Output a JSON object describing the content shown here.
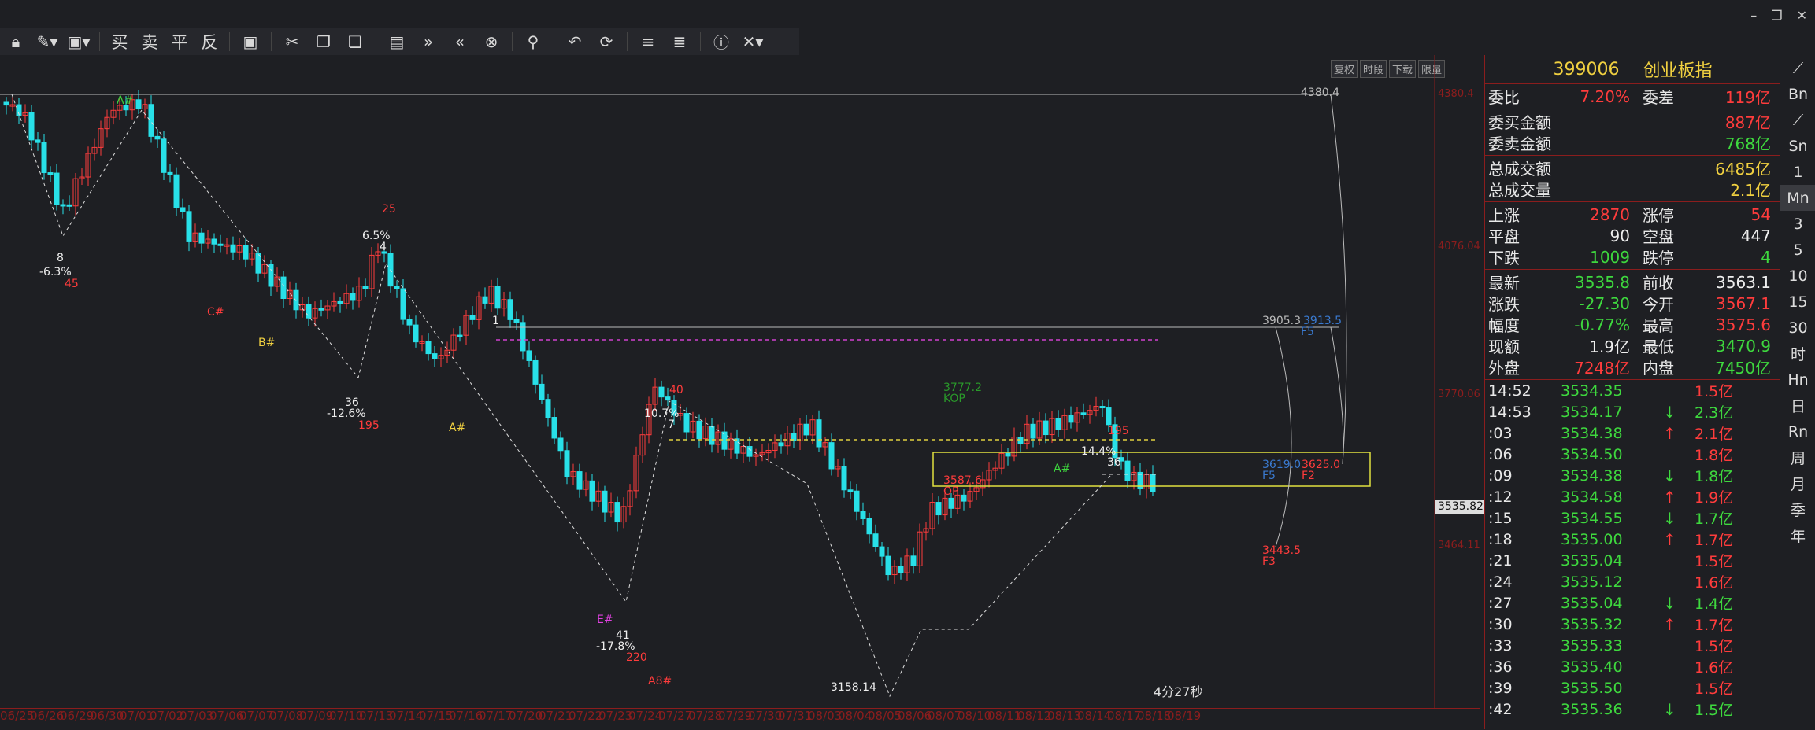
{
  "window_controls": [
    "–",
    "❐",
    "✕"
  ],
  "toolbar": {
    "lock_icon": "lock-icon",
    "draw_icon": "pen-icon",
    "save_icon": "save-icon",
    "buy": "买",
    "sell": "卖",
    "flat": "平",
    "reverse": "反",
    "icons": [
      "save-icon",
      "cut-icon",
      "copy-icon",
      "paste-icon",
      "layout-icon",
      "forward-icon",
      "back-icon",
      "cancel-icon",
      "search-icon",
      "undo-icon",
      "refresh-icon",
      "align-left-icon",
      "align-right-icon",
      "info-icon",
      "close-icon"
    ]
  },
  "chart_top_buttons": [
    "复权",
    "时段",
    "下载",
    "限量"
  ],
  "chart_labels": {
    "high_level": "4380.4",
    "level_3905": "3905.3",
    "level_3913": "3913.5",
    "f5_a": "F5",
    "level_3619": "3619.0",
    "f5_b": "F5",
    "level_3625": "3625.0",
    "f2": "F2",
    "level_3443": "3443.5",
    "f3": "F3",
    "level_3587": "3587.6",
    "op": "OP",
    "level_3777": "3777.2",
    "op2": "KOP",
    "low_label": "3158.14",
    "price_marker": "3535.82",
    "axis_4380": "4380.4",
    "axis_4076": "4076.04",
    "axis_3770": "3770.06",
    "axis_3464": "3464.11",
    "timer": "4分27秒"
  },
  "annotations": [
    {
      "text": "8",
      "color": "#eee"
    },
    {
      "text": "-6.3%",
      "color": "#eee"
    },
    {
      "text": "45",
      "color": "#ff3c3c"
    },
    {
      "text": "6.5%",
      "color": "#eee"
    },
    {
      "text": "4",
      "color": "#eee"
    },
    {
      "text": "25",
      "color": "#ff3c3c"
    },
    {
      "text": "36",
      "color": "#eee"
    },
    {
      "text": "-12.6%",
      "color": "#eee"
    },
    {
      "text": "195",
      "color": "#ff3c3c"
    },
    {
      "text": "10.7%",
      "color": "#eee"
    },
    {
      "text": "7",
      "color": "#eee"
    },
    {
      "text": "40",
      "color": "#ff3c3c"
    },
    {
      "text": "41",
      "color": "#eee"
    },
    {
      "text": "-17.8%",
      "color": "#eee"
    },
    {
      "text": "220",
      "color": "#ff3c3c"
    },
    {
      "text": "14.4%",
      "color": "#eee"
    },
    {
      "text": "36",
      "color": "#eee"
    },
    {
      "text": "195",
      "color": "#ff3c3c"
    },
    {
      "text": "1",
      "color": "#eee"
    },
    {
      "text": "A#",
      "color": "#3ed83e"
    },
    {
      "text": "B#",
      "color": "#f0d040"
    },
    {
      "text": "C#",
      "color": "#ff3c3c"
    },
    {
      "text": "A#",
      "color": "#f0d040"
    },
    {
      "text": "E#",
      "color": "#e040e0"
    },
    {
      "text": "A8#",
      "color": "#ff3c3c"
    },
    {
      "text": "A#",
      "color": "#3ed83e"
    }
  ],
  "x_axis": [
    "06/25",
    "06/26",
    "06/29",
    "06/30",
    "07/01",
    "07/02",
    "07/03",
    "07/06",
    "07/07",
    "07/08",
    "07/09",
    "07/10",
    "07/13",
    "07/14",
    "07/15",
    "07/16",
    "07/17",
    "07/20",
    "07/21",
    "07/22",
    "07/23",
    "07/24",
    "07/27",
    "07/28",
    "07/29",
    "07/30",
    "07/31",
    "08/03",
    "08/04",
    "08/05",
    "08/06",
    "08/07",
    "08/10",
    "08/11",
    "08/12",
    "08/13",
    "08/14",
    "08/17",
    "08/18",
    "08/19"
  ],
  "panel": {
    "code": "399006",
    "name": "创业板指",
    "rows1": [
      {
        "l": "委比",
        "v": "7.20%",
        "c": "#ff3c3c",
        "l2": "委差",
        "v2": "119亿",
        "c2": "#ff3c3c"
      }
    ],
    "rows2": [
      {
        "l": "委买金额",
        "v": "887亿",
        "c": "#ff3c3c"
      },
      {
        "l": "委卖金额",
        "v": "768亿",
        "c": "#3ed83e"
      }
    ],
    "rows3": [
      {
        "l": "总成交额",
        "v": "6485亿",
        "c": "#f0d040"
      },
      {
        "l": "总成交量",
        "v": "2.1亿",
        "c": "#f0d040"
      }
    ],
    "rows4": [
      {
        "l": "上涨",
        "v": "2870",
        "c": "#ff3c3c",
        "l2": "涨停",
        "v2": "54",
        "c2": "#ff3c3c"
      },
      {
        "l": "平盘",
        "v": "90",
        "c": "#eee",
        "l2": "空盘",
        "v2": "447",
        "c2": "#eee"
      },
      {
        "l": "下跌",
        "v": "1009",
        "c": "#3ed83e",
        "l2": "跌停",
        "v2": "4",
        "c2": "#3ed83e"
      }
    ],
    "rows5": [
      {
        "l": "最新",
        "v": "3535.8",
        "c": "#3ed83e",
        "l2": "前收",
        "v2": "3563.1",
        "c2": "#eee"
      },
      {
        "l": "涨跌",
        "v": "-27.30",
        "c": "#3ed83e",
        "l2": "今开",
        "v2": "3567.1",
        "c2": "#ff3c3c"
      },
      {
        "l": "幅度",
        "v": "-0.77%",
        "c": "#3ed83e",
        "l2": "最高",
        "v2": "3575.6",
        "c2": "#ff3c3c"
      },
      {
        "l": "现额",
        "v": "1.9亿",
        "c": "#eee",
        "l2": "最低",
        "v2": "3470.9",
        "c2": "#3ed83e"
      },
      {
        "l": "外盘",
        "v": "7248亿",
        "c": "#ff3c3c",
        "l2": "内盘",
        "v2": "7450亿",
        "c2": "#3ed83e"
      }
    ],
    "ticks": [
      {
        "t": "14:52",
        "p": "3534.35",
        "a": "",
        "ac": "#eee",
        "v": "1.5亿",
        "vc": "#ff3c3c"
      },
      {
        "t": "14:53",
        "p": "3534.17",
        "a": "↓",
        "ac": "#3ed83e",
        "v": "2.3亿",
        "vc": "#3ed83e"
      },
      {
        "t": ":03",
        "p": "3534.38",
        "a": "↑",
        "ac": "#ff3c3c",
        "v": "2.1亿",
        "vc": "#ff3c3c"
      },
      {
        "t": ":06",
        "p": "3534.50",
        "a": "",
        "ac": "#eee",
        "v": "1.8亿",
        "vc": "#ff3c3c"
      },
      {
        "t": ":09",
        "p": "3534.38",
        "a": "↓",
        "ac": "#3ed83e",
        "v": "1.8亿",
        "vc": "#3ed83e"
      },
      {
        "t": ":12",
        "p": "3534.58",
        "a": "↑",
        "ac": "#ff3c3c",
        "v": "1.9亿",
        "vc": "#ff3c3c"
      },
      {
        "t": ":15",
        "p": "3534.55",
        "a": "↓",
        "ac": "#3ed83e",
        "v": "1.7亿",
        "vc": "#3ed83e"
      },
      {
        "t": ":18",
        "p": "3535.00",
        "a": "↑",
        "ac": "#ff3c3c",
        "v": "1.7亿",
        "vc": "#ff3c3c"
      },
      {
        "t": ":21",
        "p": "3535.04",
        "a": "",
        "ac": "#eee",
        "v": "1.5亿",
        "vc": "#ff3c3c"
      },
      {
        "t": ":24",
        "p": "3535.12",
        "a": "",
        "ac": "#eee",
        "v": "1.6亿",
        "vc": "#ff3c3c"
      },
      {
        "t": ":27",
        "p": "3535.04",
        "a": "↓",
        "ac": "#3ed83e",
        "v": "1.4亿",
        "vc": "#3ed83e"
      },
      {
        "t": ":30",
        "p": "3535.32",
        "a": "↑",
        "ac": "#ff3c3c",
        "v": "1.7亿",
        "vc": "#ff3c3c"
      },
      {
        "t": ":33",
        "p": "3535.33",
        "a": "",
        "ac": "#eee",
        "v": "1.5亿",
        "vc": "#ff3c3c"
      },
      {
        "t": ":36",
        "p": "3535.40",
        "a": "",
        "ac": "#eee",
        "v": "1.6亿",
        "vc": "#ff3c3c"
      },
      {
        "t": ":39",
        "p": "3535.50",
        "a": "",
        "ac": "#eee",
        "v": "1.5亿",
        "vc": "#ff3c3c"
      },
      {
        "t": ":42",
        "p": "3535.36",
        "a": "↓",
        "ac": "#3ed83e",
        "v": "1.5亿",
        "vc": "#3ed83e"
      }
    ]
  },
  "right_rail": [
    "⟋",
    "Bn",
    "⟋",
    "Sn",
    "1",
    "Mn",
    "3",
    "5",
    "10",
    "15",
    "30",
    "时",
    "Hn",
    "日",
    "Rn",
    "周",
    "月",
    "季",
    "年"
  ]
}
